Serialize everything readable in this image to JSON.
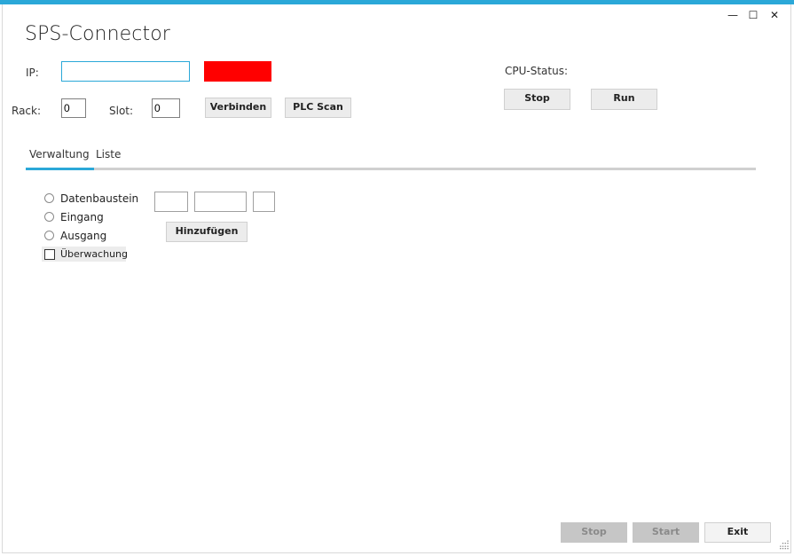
{
  "app": {
    "title": "SPS-Connector"
  },
  "window_controls": {
    "minimize": "—",
    "maximize": "☐",
    "close": "✕"
  },
  "connection": {
    "ip_label": "IP:",
    "ip_value": "",
    "status_color": "#ff0000",
    "rack_label": "Rack:",
    "rack_value": "0",
    "slot_label": "Slot:",
    "slot_value": "0",
    "connect_label": "Verbinden",
    "scan_label": "PLC Scan"
  },
  "cpu": {
    "status_label": "CPU-Status:",
    "stop_label": "Stop",
    "run_label": "Run"
  },
  "tabs": [
    {
      "label": "Verwaltung",
      "active": true
    },
    {
      "label": "Liste",
      "active": false
    }
  ],
  "verwaltung": {
    "options": [
      {
        "label": "Datenbaustein"
      },
      {
        "label": "Eingang"
      },
      {
        "label": "Ausgang"
      }
    ],
    "monitor_label": "Überwachung",
    "field1": "",
    "field2": "",
    "field3": "",
    "add_label": "Hinzufügen"
  },
  "footer": {
    "stop_label": "Stop",
    "start_label": "Start",
    "exit_label": "Exit"
  },
  "colors": {
    "accent": "#2ba8d8",
    "status_red": "#ff0000"
  }
}
